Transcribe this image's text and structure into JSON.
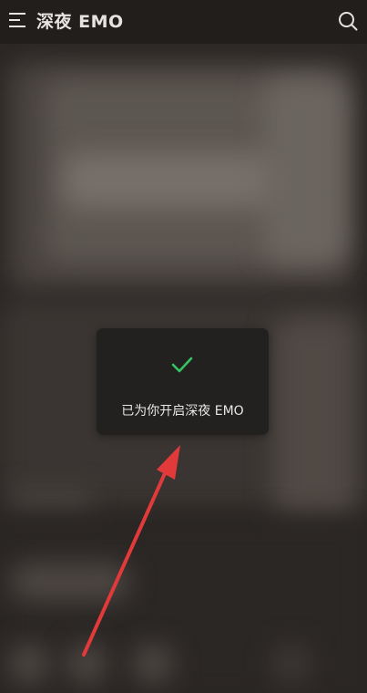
{
  "header": {
    "title": "深夜 EMO",
    "menu_icon": "hamburger-menu-icon",
    "search_icon": "search-icon"
  },
  "toast": {
    "icon": "check-icon",
    "message": "已为你开启深夜 EMO"
  },
  "colors": {
    "check": "#34c463",
    "arrow": "#e23a3a",
    "toast_bg": "#232120"
  }
}
